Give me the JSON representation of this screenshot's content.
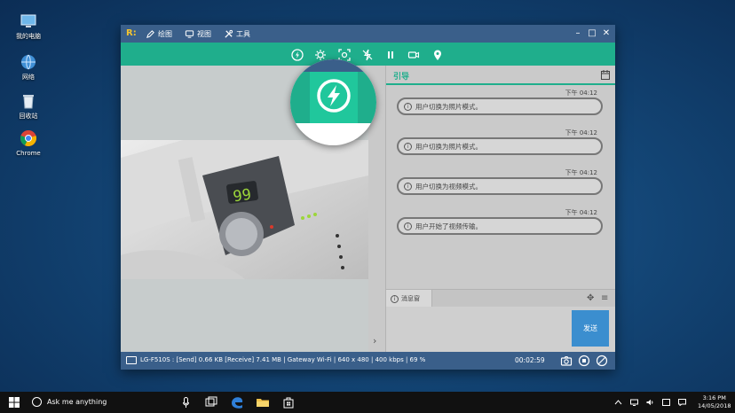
{
  "desktop": {
    "icons": [
      {
        "label": "我的电脑"
      },
      {
        "label": "网络"
      },
      {
        "label": "回收站"
      },
      {
        "label": "Chrome"
      }
    ]
  },
  "window": {
    "logo": "R:",
    "menu": [
      {
        "label": "绘图",
        "icon": "pencil-icon"
      },
      {
        "label": "视图",
        "icon": "monitor-icon"
      },
      {
        "label": "工具",
        "icon": "tools-icon"
      }
    ],
    "controls": {
      "minimize": "–",
      "maximize": "□",
      "close": "✕"
    },
    "toolbar_icons": [
      "flash-icon",
      "settings-gear-icon",
      "capture-icon",
      "flash-off-icon",
      "pause-icon",
      "video-camera-icon",
      "location-pin-icon"
    ]
  },
  "chat": {
    "title": "引导",
    "messages": [
      {
        "time": "下午 04:12",
        "text": "用户切换为照片模式。"
      },
      {
        "time": "下午 04:12",
        "text": "用户切换为照片模式。"
      },
      {
        "time": "下午 04:12",
        "text": "用户切换为视频模式。"
      },
      {
        "time": "下午 04:12",
        "text": "用户开始了视频传输。"
      }
    ],
    "input_tab": "消息窗",
    "send_label": "发送"
  },
  "status": {
    "text": "LG-F510S : [Send] 0.66 KB  [Receive] 7.41 MB | Gateway Wi-Fi | 640 x 480 | 400 kbps | 69 %",
    "timer": "00:02:59"
  },
  "taskbar": {
    "search_placeholder": "Ask me anything",
    "clock_time": "3:16 PM",
    "clock_date": "14/05/2018"
  },
  "colors": {
    "accent": "#1fae8c",
    "titlebar": "#3a5f8a",
    "send": "#3b8ecf"
  }
}
